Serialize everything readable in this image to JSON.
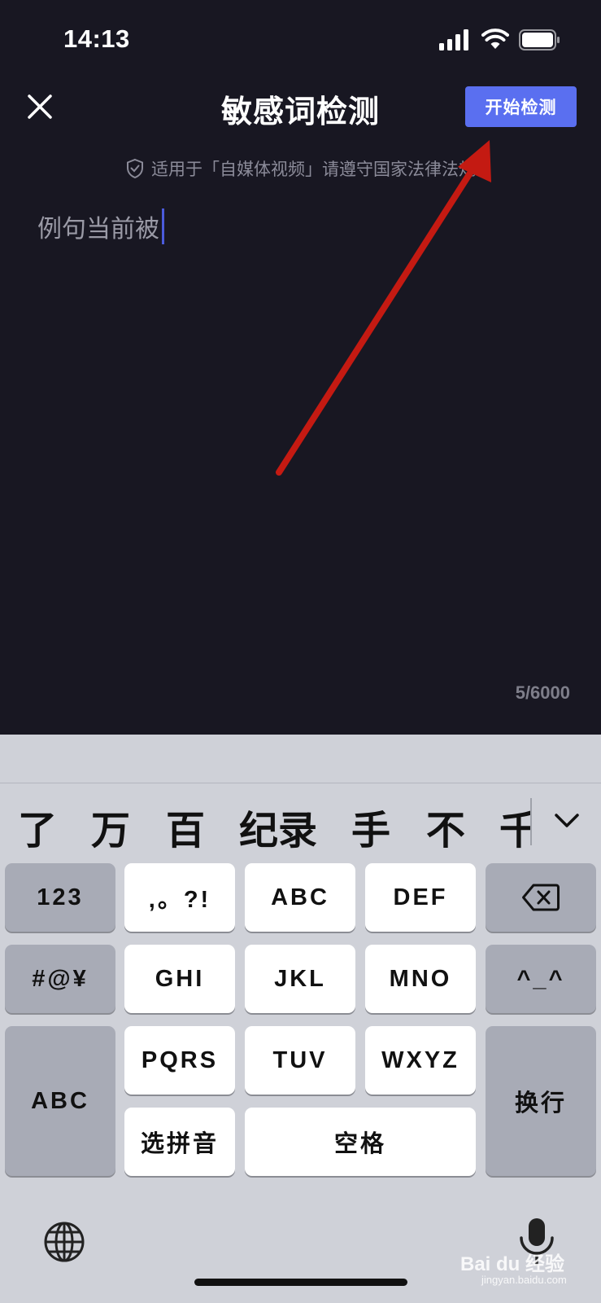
{
  "status_bar": {
    "time": "14:13"
  },
  "nav": {
    "title": "敏感词检测",
    "start_button": "开始检测"
  },
  "notice": {
    "text": "适用于「自媒体视频」请遵守国家法律法规"
  },
  "editor": {
    "text": "例句当前被"
  },
  "counter": {
    "text": "5/6000"
  },
  "candidates": [
    "了",
    "万",
    "百",
    "纪录",
    "手",
    "不",
    "千"
  ],
  "keyboard": {
    "row1": [
      "123",
      ",。?!",
      "ABC",
      "DEF"
    ],
    "row2": [
      "#@¥",
      "GHI",
      "JKL",
      "MNO",
      "^_^"
    ],
    "row3": [
      "ABC",
      "PQRS",
      "TUV",
      "WXYZ",
      "换行"
    ],
    "row4": [
      "选拼音",
      "空格"
    ]
  },
  "watermark": {
    "brand": "Bai du 经验",
    "url": "jingyan.baidu.com"
  },
  "colors": {
    "accent": "#5a6ff0",
    "background": "#181722",
    "keyboard_bg": "#cfd1d8",
    "annotation_arrow": "#c41a12"
  }
}
